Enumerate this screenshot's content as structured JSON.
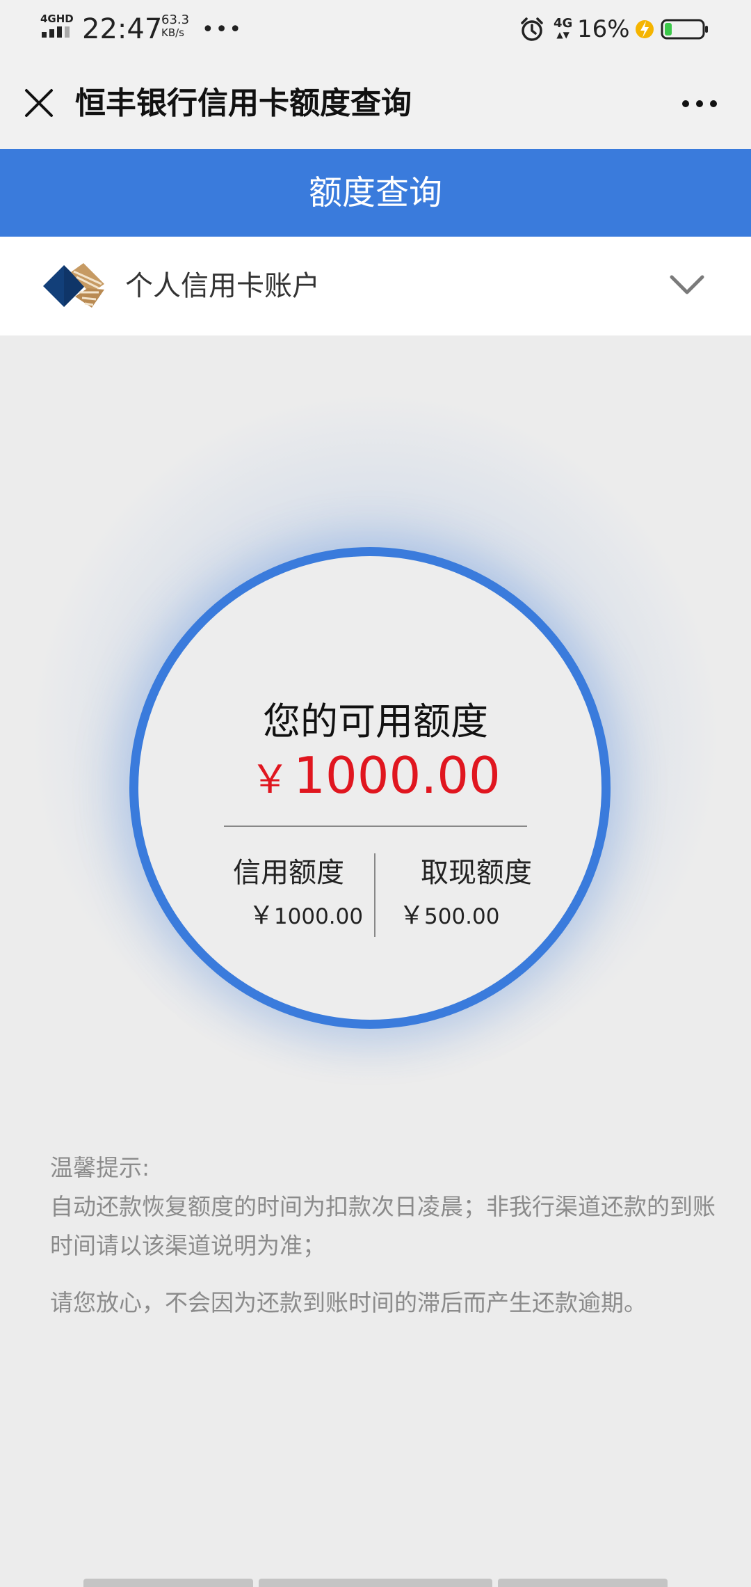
{
  "status_bar": {
    "network": "4GHD",
    "time": "22:47",
    "speed_value": "63.3",
    "speed_unit": "KB/s",
    "more": "•••",
    "net_4g": "4G",
    "battery": "16%"
  },
  "title_bar": {
    "title": "恒丰银行信用卡额度查询",
    "menu": "•••"
  },
  "header": {
    "title": "额度查询"
  },
  "account": {
    "label": "个人信用卡账户"
  },
  "quota": {
    "available_label": "您的可用额度",
    "currency": "￥",
    "available_value": "1000.00",
    "credit_label": "信用额度",
    "credit_value": "1000.00",
    "cash_label": "取现额度",
    "cash_value": "500.00"
  },
  "tips": {
    "title": "温馨提示:",
    "line1": "自动还款恢复额度的时间为扣款次日凌晨；非我行渠道还款的到账时间请以该渠道说明为准；",
    "line2": "请您放心，不会因为还款到账时间的滞后而产生还款逾期。"
  },
  "colors": {
    "accent": "#3a7bdc",
    "amount": "#e0161f",
    "battery_fill": "#3cc84a",
    "bolt": "#f5b400"
  }
}
